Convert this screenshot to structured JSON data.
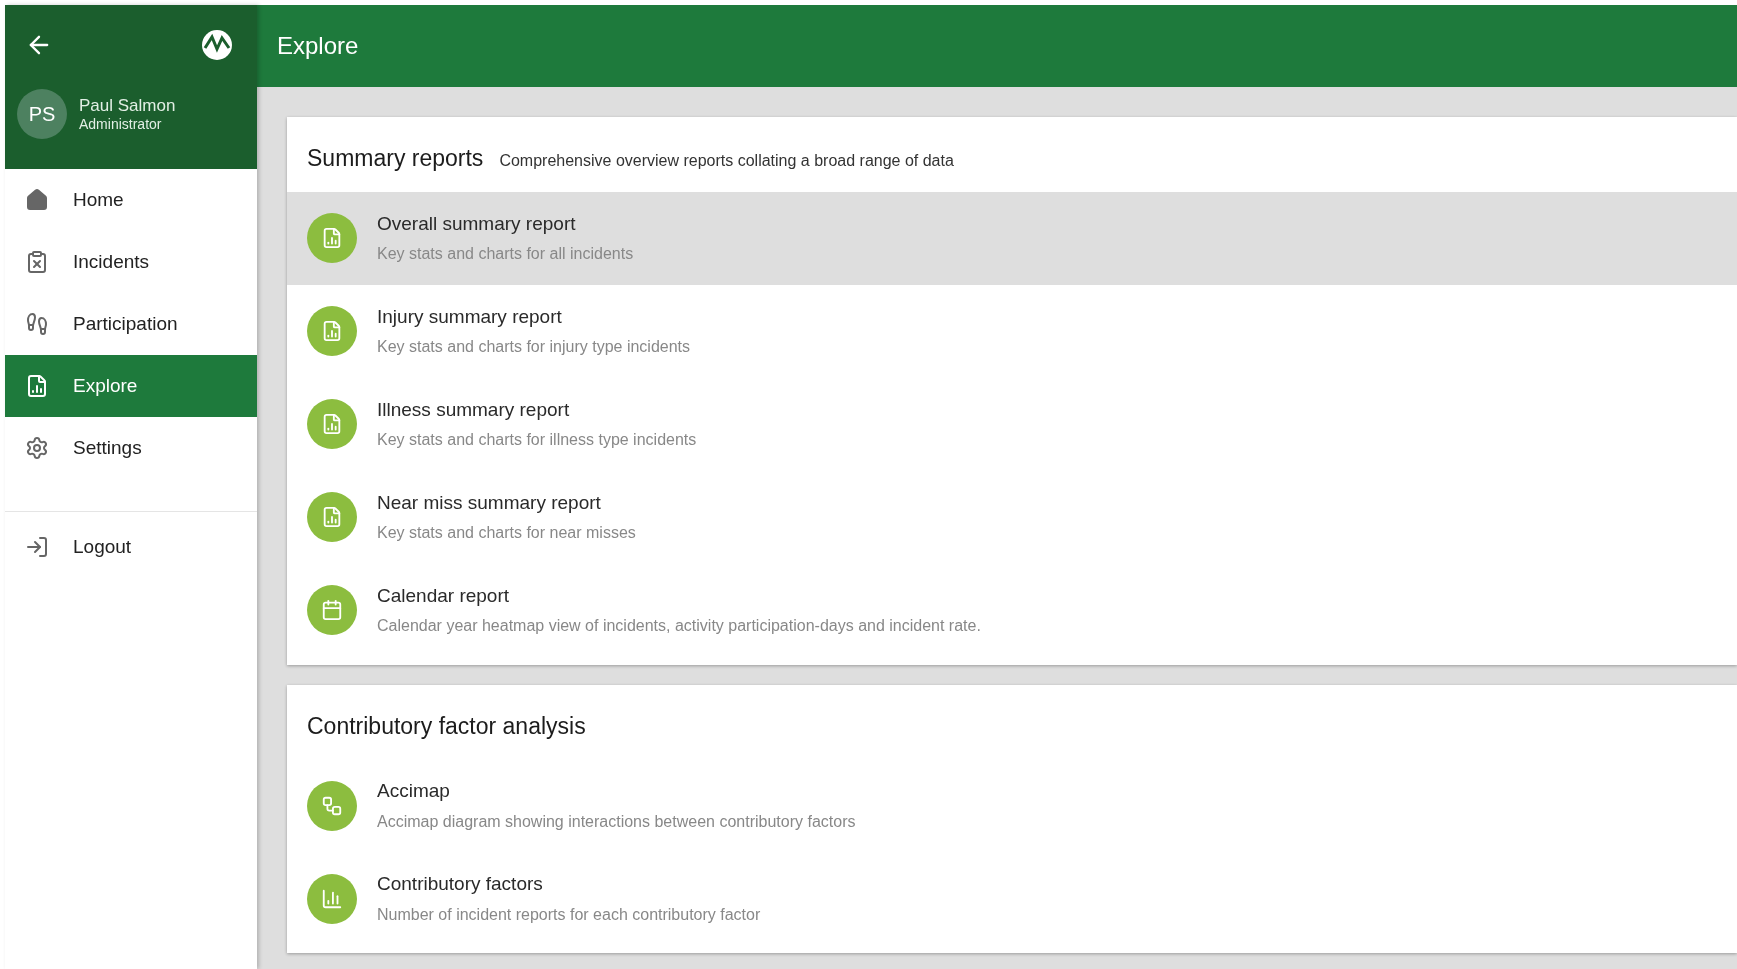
{
  "sidebar": {
    "user": {
      "initials": "PS",
      "name": "Paul Salmon",
      "role": "Administrator"
    },
    "items": [
      {
        "label": "Home",
        "kind": "home",
        "selected": false
      },
      {
        "label": "Incidents",
        "kind": "incidents",
        "selected": false
      },
      {
        "label": "Participation",
        "kind": "participation",
        "selected": false
      },
      {
        "label": "Explore",
        "kind": "explore",
        "selected": true
      },
      {
        "label": "Settings",
        "kind": "settings",
        "selected": false
      }
    ],
    "footer_items": [
      {
        "label": "Logout",
        "kind": "logout"
      }
    ]
  },
  "header": {
    "title": "Explore"
  },
  "sections": [
    {
      "title": "Summary reports",
      "subtitle": "Comprehensive overview reports collating a broad range of data",
      "items": [
        {
          "title": "Overall summary report",
          "description": "Key stats and charts for all incidents",
          "kind": "report",
          "selected": true
        },
        {
          "title": "Injury summary report",
          "description": "Key stats and charts for injury type incidents",
          "kind": "report",
          "selected": false
        },
        {
          "title": "Illness summary report",
          "description": "Key stats and charts for illness type incidents",
          "kind": "report",
          "selected": false
        },
        {
          "title": "Near miss summary report",
          "description": "Key stats and charts for near misses",
          "kind": "report",
          "selected": false
        },
        {
          "title": "Calendar report",
          "description": "Calendar year heatmap view of incidents, activity participation-days and incident rate.",
          "kind": "calendar",
          "selected": false
        }
      ]
    },
    {
      "title": "Contributory factor analysis",
      "items": [
        {
          "title": "Accimap",
          "description": "Accimap diagram showing interactions between contributory factors",
          "kind": "diagram",
          "selected": false
        },
        {
          "title": "Contributory factors",
          "description": "Number of incident reports for each contributory factor",
          "kind": "bars",
          "selected": false
        }
      ]
    }
  ]
}
